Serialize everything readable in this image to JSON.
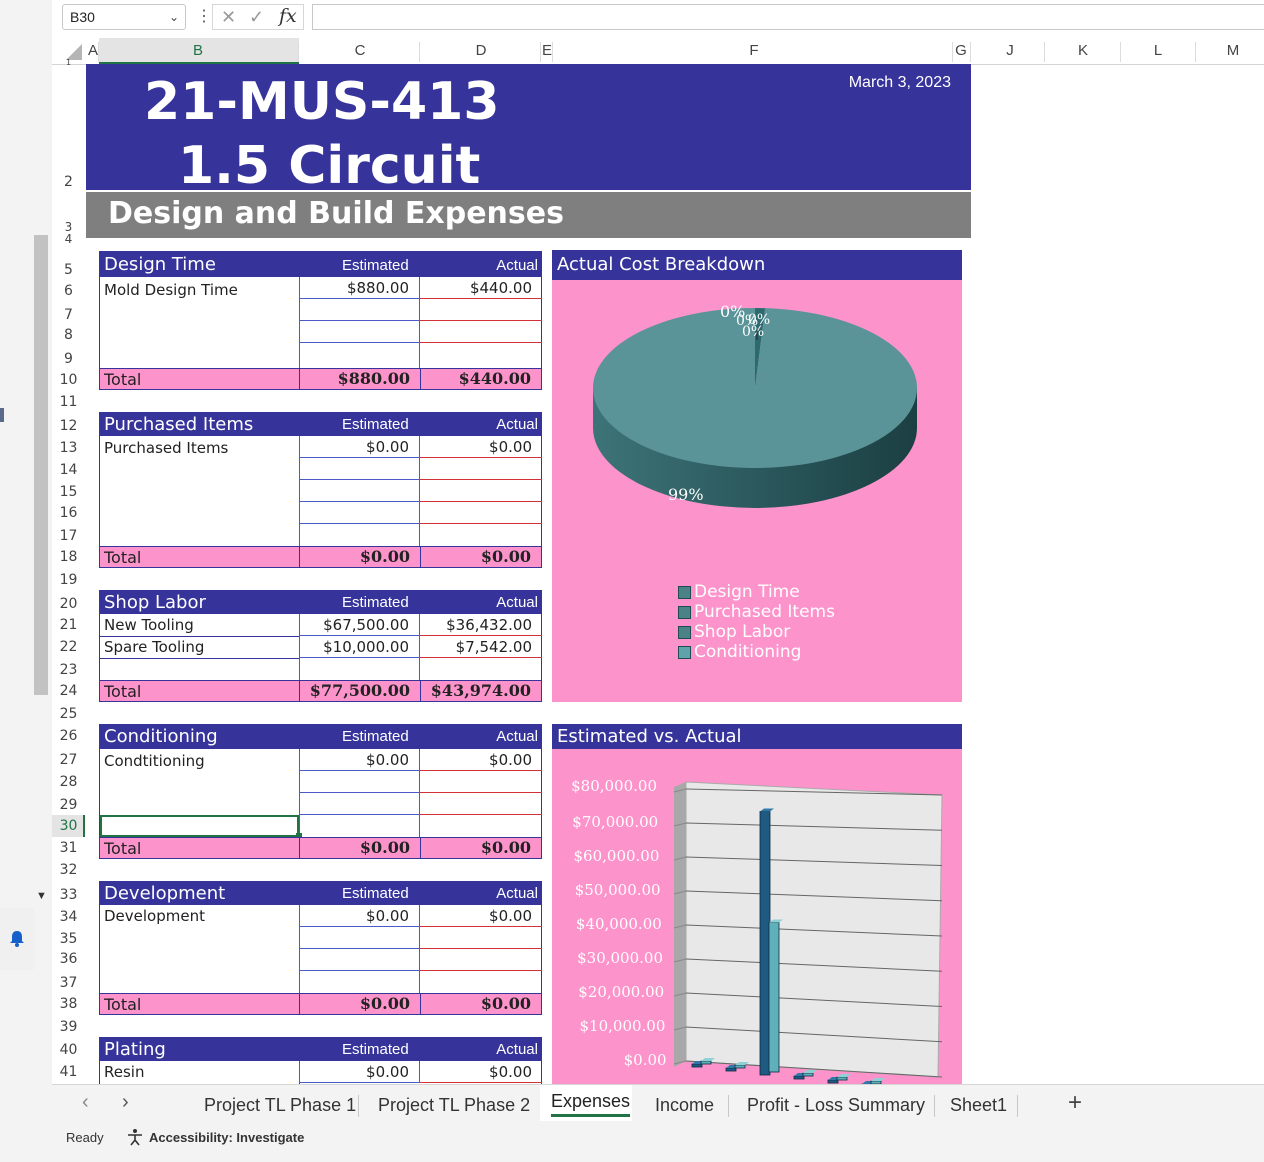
{
  "formula_bar": {
    "cell_ref": "B30",
    "fx": "fx",
    "formula": ""
  },
  "columns": [
    "A",
    "B",
    "C",
    "D",
    "E",
    "F",
    "G",
    "J",
    "K",
    "L",
    "M"
  ],
  "rows": [
    "1",
    "2",
    "3",
    "4",
    "5",
    "6",
    "7",
    "8",
    "9",
    "10",
    "11",
    "12",
    "13",
    "14",
    "15",
    "16",
    "17",
    "18",
    "19",
    "20",
    "21",
    "22",
    "23",
    "24",
    "25",
    "26",
    "27",
    "28",
    "29",
    "30",
    "31",
    "32",
    "33",
    "34",
    "35",
    "36",
    "37",
    "38",
    "39",
    "40",
    "41"
  ],
  "banner": {
    "title_line1": "21-MUS-413",
    "title_line2": "1.5 Circuit",
    "date": "March 3, 2023",
    "subtitle": "Design and Build Expenses"
  },
  "col_labels": {
    "estimated": "Estimated",
    "actual": "Actual",
    "total": "Total"
  },
  "tables": {
    "design": {
      "name": "Design Time",
      "items": [
        {
          "label": "Mold Design Time",
          "est": "$880.00",
          "act": "$440.00"
        }
      ],
      "total_est": "$880.00",
      "total_act": "$440.00"
    },
    "purchased": {
      "name": "Purchased Items",
      "items": [
        {
          "label": "Purchased Items",
          "est": "$0.00",
          "act": "$0.00"
        }
      ],
      "total_est": "$0.00",
      "total_act": "$0.00"
    },
    "labor": {
      "name": "Shop Labor",
      "items": [
        {
          "label": "New Tooling",
          "est": "$67,500.00",
          "act": "$36,432.00"
        },
        {
          "label": "Spare Tooling",
          "est": "$10,000.00",
          "act": "$7,542.00"
        }
      ],
      "total_est": "$77,500.00",
      "total_act": "$43,974.00"
    },
    "conditioning": {
      "name": "Conditioning",
      "items": [
        {
          "label": "Condtitioning",
          "est": "$0.00",
          "act": "$0.00"
        }
      ],
      "total_est": "$0.00",
      "total_act": "$0.00"
    },
    "development": {
      "name": "Development",
      "items": [
        {
          "label": "Development",
          "est": "$0.00",
          "act": "$0.00"
        }
      ],
      "total_est": "$0.00",
      "total_act": "$0.00"
    },
    "plating": {
      "name": "Plating",
      "items": [
        {
          "label": "Resin",
          "est": "$0.00",
          "act": "$0.00"
        }
      ]
    }
  },
  "chart_data": [
    {
      "type": "pie",
      "title": "Actual Cost Breakdown",
      "categories": [
        "Design Time",
        "Purchased Items",
        "Shop Labor",
        "Conditioning"
      ],
      "values": [
        1,
        0,
        99,
        0
      ],
      "data_labels": [
        "0%",
        "0%",
        "0%",
        "0%",
        "99%"
      ],
      "legend": "bottom",
      "color": "#5a9499"
    },
    {
      "type": "bar",
      "title": "Estimated vs. Actual",
      "ylim": [
        0,
        80000
      ],
      "yticks": [
        "$80,000.00",
        "$70,000.00",
        "$60,000.00",
        "$50,000.00",
        "$40,000.00",
        "$30,000.00",
        "$20,000.00",
        "$10,000.00",
        "$0.00"
      ],
      "series": [
        {
          "name": "Estimated",
          "values": [
            880,
            0,
            77500,
            0,
            0,
            0
          ]
        },
        {
          "name": "Actual",
          "values": [
            440,
            0,
            43974,
            0,
            0,
            0
          ]
        }
      ],
      "colors": [
        "#1f5a82",
        "#5fb0b8"
      ]
    }
  ],
  "sheet_tabs": [
    "Project TL Phase 1",
    "Project TL Phase 2",
    "Expenses",
    "Income",
    "Profit - Loss Summary",
    "Sheet1"
  ],
  "active_tab": "Expenses",
  "status": {
    "ready": "Ready",
    "accessibility": "Accessibility: Investigate"
  }
}
